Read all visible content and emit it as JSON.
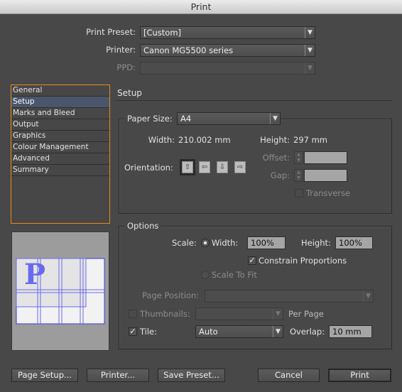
{
  "window": {
    "title": "Print"
  },
  "top": {
    "preset_label": "Print Preset:",
    "preset_value": "[Custom]",
    "printer_label": "Printer:",
    "printer_value": "Canon MG5500 series",
    "ppd_label": "PPD:",
    "ppd_value": ""
  },
  "sidebar": {
    "items": [
      {
        "label": "General"
      },
      {
        "label": "Setup",
        "selected": true
      },
      {
        "label": "Marks and Bleed"
      },
      {
        "label": "Output"
      },
      {
        "label": "Graphics"
      },
      {
        "label": "Colour Management"
      },
      {
        "label": "Advanced"
      },
      {
        "label": "Summary"
      }
    ]
  },
  "setup": {
    "heading": "Setup",
    "paper_size_label": "Paper Size:",
    "paper_size_value": "A4",
    "width_label": "Width:",
    "width_value": "210.002 mm",
    "height_label": "Height:",
    "height_value": "297 mm",
    "orientation_label": "Orientation:",
    "orientation_options": [
      "portrait",
      "landscape",
      "reverse-portrait",
      "reverse-landscape"
    ],
    "orientation_selected": "portrait",
    "offset_label": "Offset:",
    "offset_value": "",
    "gap_label": "Gap:",
    "gap_value": "",
    "transverse_label": "Transverse",
    "transverse_checked": false
  },
  "options": {
    "legend": "Options",
    "scale_label": "Scale:",
    "width_radio_label": "Width:",
    "width_value": "100%",
    "height_label": "Height:",
    "height_value": "100%",
    "constrain_label": "Constrain Proportions",
    "constrain_checked": true,
    "scale_to_fit_label": "Scale To Fit",
    "page_position_label": "Page Position:",
    "page_position_value": "",
    "thumbnails_label": "Thumbnails:",
    "thumbnails_checked": false,
    "thumbnails_value": "",
    "per_page_label": "Per Page",
    "tile_label": "Tile:",
    "tile_checked": true,
    "tile_value": "Auto",
    "overlap_label": "Overlap:",
    "overlap_value": "10 mm"
  },
  "preview": {
    "letter": "P"
  },
  "buttons": {
    "page_setup": "Page Setup...",
    "printer": "Printer...",
    "save_preset": "Save Preset...",
    "cancel": "Cancel",
    "print": "Print"
  },
  "colors": {
    "accent": "#e8891c",
    "selection": "#4a5669",
    "preview_lines": "#3a3ae0"
  }
}
